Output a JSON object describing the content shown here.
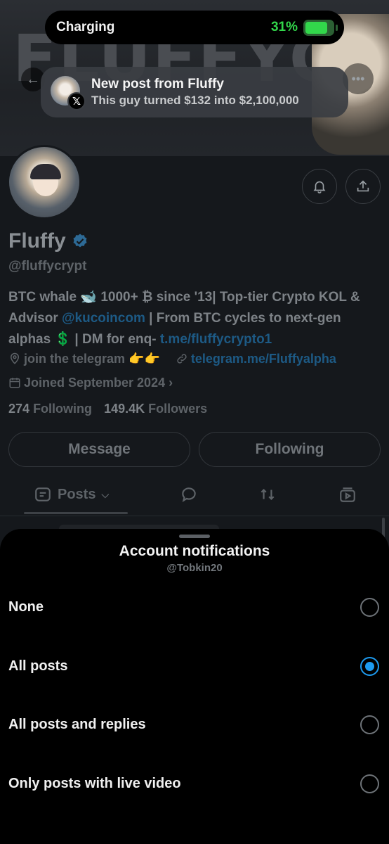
{
  "status_bar": {
    "left_text": "Charging",
    "battery_percent": "31%",
    "battery_level": 0.31
  },
  "notification": {
    "title": "New post from Fluffy",
    "body": "This guy turned $132 into $2,100,000"
  },
  "profile": {
    "banner_text": "FLUFFYCRYPTO",
    "name": "Fluffy",
    "handle": "@fluffycrypt",
    "bio": {
      "part1": "BTC whale 🐋 1000+ ₿ since '13| Top-tier Crypto KOL & Advisor ",
      "mention": "@kucoincom",
      "part2": " | From BTC cycles to next-gen alphas 💲 | DM for enq- ",
      "link": "t.me/fluffycrypto1"
    },
    "location": "join the telegram 👉👉",
    "website": "telegram.me/Fluffyalpha",
    "joined": "Joined September 2024",
    "following_count": "274",
    "following_label": "Following",
    "followers_count": "149.4K",
    "followers_label": "Followers",
    "message_button": "Message",
    "following_button": "Following",
    "tabs": {
      "posts_label": "Posts"
    }
  },
  "sheet": {
    "title": "Account notifications",
    "subtitle": "@Tobkin20",
    "options": [
      {
        "label": "None",
        "selected": false
      },
      {
        "label": "All posts",
        "selected": true
      },
      {
        "label": "All posts and replies",
        "selected": false
      },
      {
        "label": "Only posts with live video",
        "selected": false
      }
    ]
  },
  "colors": {
    "accent": "#1d9bf0",
    "battery_green": "#32d74b"
  }
}
